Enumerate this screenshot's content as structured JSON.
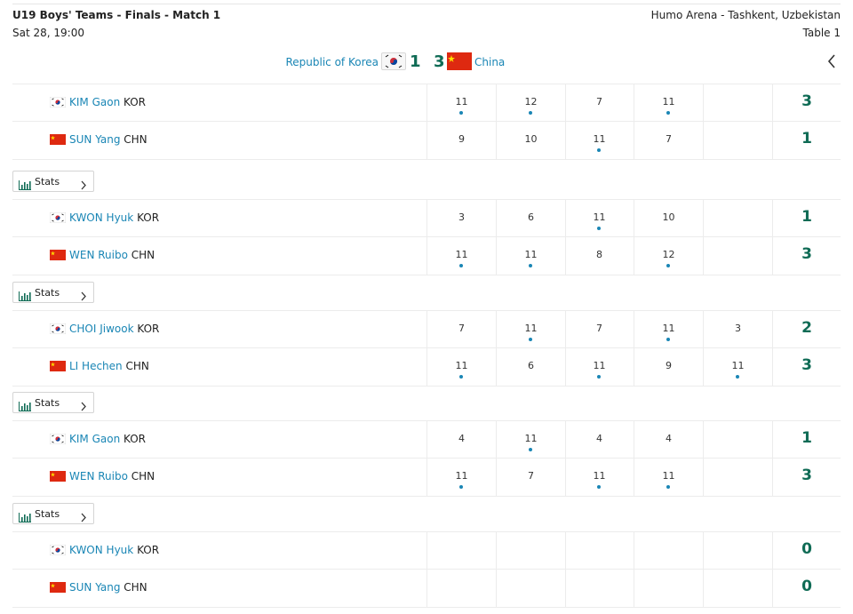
{
  "header": {
    "title": "U19 Boys' Teams - Finals - Match 1",
    "date": "Sat 28, 19:00",
    "venue": "Humo Arena - Tashkent, Uzbekistan",
    "table": "Table 1"
  },
  "teams": {
    "home": {
      "name": "Republic of Korea",
      "score": "1",
      "flag": "korea-flag-icon"
    },
    "away": {
      "name": "China",
      "score": "3",
      "flag": "china-flag-icon"
    }
  },
  "stats_label": "Stats",
  "matches": [
    {
      "players": [
        {
          "name": "KIM Gaon",
          "nat": "KOR",
          "flag": "kor",
          "games": [
            "11",
            "12",
            "7",
            "11",
            ""
          ],
          "won": [
            true,
            true,
            false,
            true,
            false
          ],
          "total": "3"
        },
        {
          "name": "SUN Yang",
          "nat": "CHN",
          "flag": "chn",
          "games": [
            "9",
            "10",
            "11",
            "7",
            ""
          ],
          "won": [
            false,
            false,
            true,
            false,
            false
          ],
          "total": "1"
        }
      ]
    },
    {
      "players": [
        {
          "name": "KWON Hyuk",
          "nat": "KOR",
          "flag": "kor",
          "games": [
            "3",
            "6",
            "11",
            "10",
            ""
          ],
          "won": [
            false,
            false,
            true,
            false,
            false
          ],
          "total": "1"
        },
        {
          "name": "WEN Ruibo",
          "nat": "CHN",
          "flag": "chn",
          "games": [
            "11",
            "11",
            "8",
            "12",
            ""
          ],
          "won": [
            true,
            true,
            false,
            true,
            false
          ],
          "total": "3"
        }
      ]
    },
    {
      "players": [
        {
          "name": "CHOI Jiwook",
          "nat": "KOR",
          "flag": "kor",
          "games": [
            "7",
            "11",
            "7",
            "11",
            "3"
          ],
          "won": [
            false,
            true,
            false,
            true,
            false
          ],
          "total": "2"
        },
        {
          "name": "LI Hechen",
          "nat": "CHN",
          "flag": "chn",
          "games": [
            "11",
            "6",
            "11",
            "9",
            "11"
          ],
          "won": [
            true,
            false,
            true,
            false,
            true
          ],
          "total": "3"
        }
      ]
    },
    {
      "players": [
        {
          "name": "KIM Gaon",
          "nat": "KOR",
          "flag": "kor",
          "games": [
            "4",
            "11",
            "4",
            "4",
            ""
          ],
          "won": [
            false,
            true,
            false,
            false,
            false
          ],
          "total": "1"
        },
        {
          "name": "WEN Ruibo",
          "nat": "CHN",
          "flag": "chn",
          "games": [
            "11",
            "7",
            "11",
            "11",
            ""
          ],
          "won": [
            true,
            false,
            true,
            true,
            false
          ],
          "total": "3"
        }
      ]
    },
    {
      "players": [
        {
          "name": "KWON Hyuk",
          "nat": "KOR",
          "flag": "kor",
          "games": [
            "",
            "",
            "",
            "",
            ""
          ],
          "won": [
            false,
            false,
            false,
            false,
            false
          ],
          "total": "0"
        },
        {
          "name": "SUN Yang",
          "nat": "CHN",
          "flag": "chn",
          "games": [
            "",
            "",
            "",
            "",
            ""
          ],
          "won": [
            false,
            false,
            false,
            false,
            false
          ],
          "total": "0"
        }
      ]
    }
  ],
  "colors": {
    "link": "#1a86b5",
    "score": "#0f6b55",
    "china_red": "#de2910"
  }
}
